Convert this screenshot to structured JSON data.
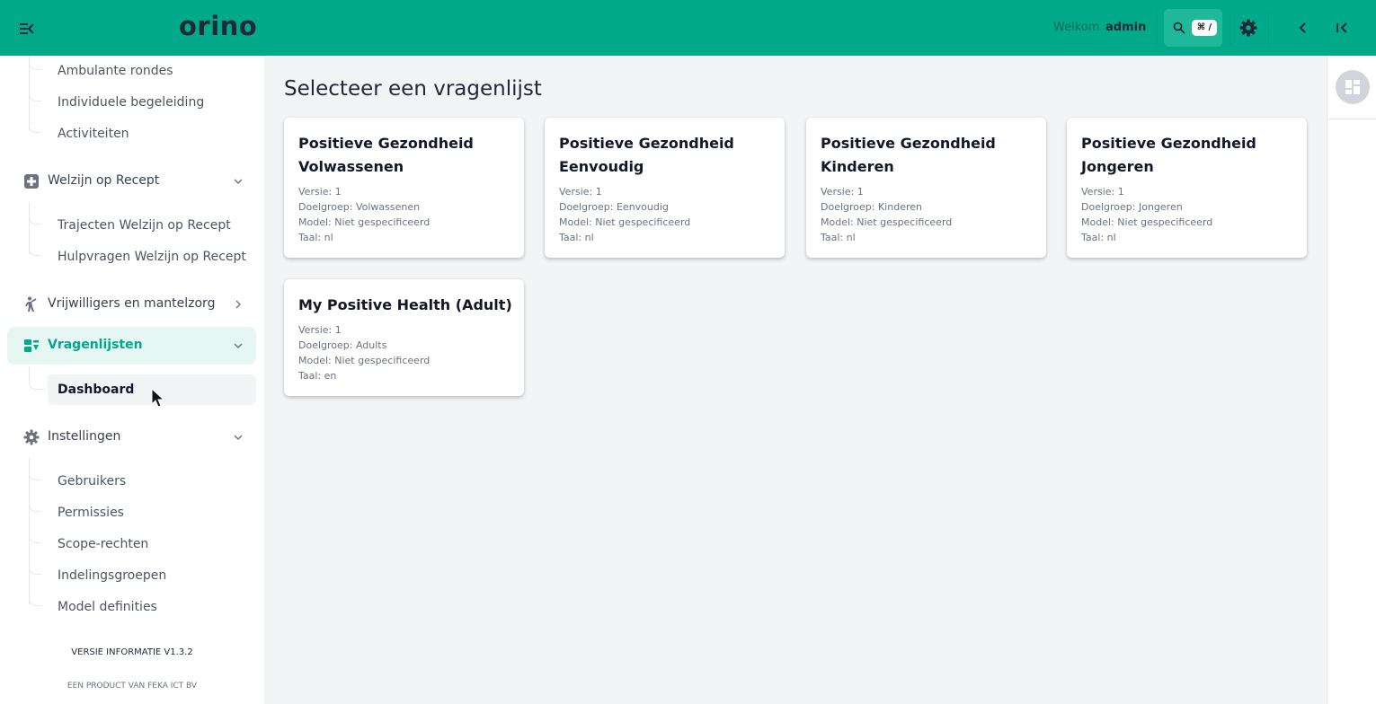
{
  "header": {
    "logo": "orino",
    "welcome_label": "Welkom",
    "user": "admin",
    "search_shortcut": "⌘ /"
  },
  "sidebar": {
    "ambulant_items": [
      "Ambulante rondes",
      "Individuele begeleiding",
      "Activiteiten"
    ],
    "groups": {
      "welzijn": {
        "label": "Welzijn op Recept",
        "icon": "plus-square-icon",
        "expanded": true
      },
      "vrijwilligers": {
        "label": "Vrijwilligers en mantelzorg",
        "icon": "volunteer-icon",
        "expanded": false
      },
      "vragenlijsten": {
        "label": "Vragenlijsten",
        "icon": "questionnaire-icon",
        "expanded": true,
        "active": true
      },
      "instellingen": {
        "label": "Instellingen",
        "icon": "gear-icon",
        "expanded": true
      }
    },
    "welzijn_items": [
      "Trajecten Welzijn op Recept",
      "Hulpvragen Welzijn op Recept"
    ],
    "vragenlijsten_items": [
      "Dashboard"
    ],
    "instellingen_items": [
      "Gebruikers",
      "Permissies",
      "Scope-rechten",
      "Indelingsgroepen",
      "Model definities"
    ],
    "version_info": "VERSIE INFORMATIE V1.3.2",
    "product_info": "EEN PRODUCT VAN FEKA ICT BV"
  },
  "main": {
    "title": "Selecteer een vragenlijst",
    "cards": [
      {
        "title": "Positieve Gezondheid Volwassenen",
        "versie": "Versie: 1",
        "doelgroep": "Doelgroep: Volwassenen",
        "model": "Model: Niet gespecificeerd",
        "taal": "Taal: nl"
      },
      {
        "title": "Positieve Gezondheid Eenvoudig",
        "versie": "Versie: 1",
        "doelgroep": "Doelgroep: Eenvoudig",
        "model": "Model: Niet gespecificeerd",
        "taal": "Taal: nl"
      },
      {
        "title": "Positieve Gezondheid Kinderen",
        "versie": "Versie: 1",
        "doelgroep": "Doelgroep: Kinderen",
        "model": "Model: Niet gespecificeerd",
        "taal": "Taal: nl"
      },
      {
        "title": "Positieve Gezondheid Jongeren",
        "versie": "Versie: 1",
        "doelgroep": "Doelgroep: Jongeren",
        "model": "Model: Niet gespecificeerd",
        "taal": "Taal: nl"
      },
      {
        "title": "My Positive Health (Adult)",
        "versie": "Versie: 1",
        "doelgroep": "Doelgroep: Adults",
        "model": "Model: Niet gespecificeerd",
        "taal": "Taal: en"
      }
    ]
  },
  "colors": {
    "brand": "#00a98a",
    "active_bg": "#e6f6f2",
    "page_bg": "#f3f4f6"
  }
}
